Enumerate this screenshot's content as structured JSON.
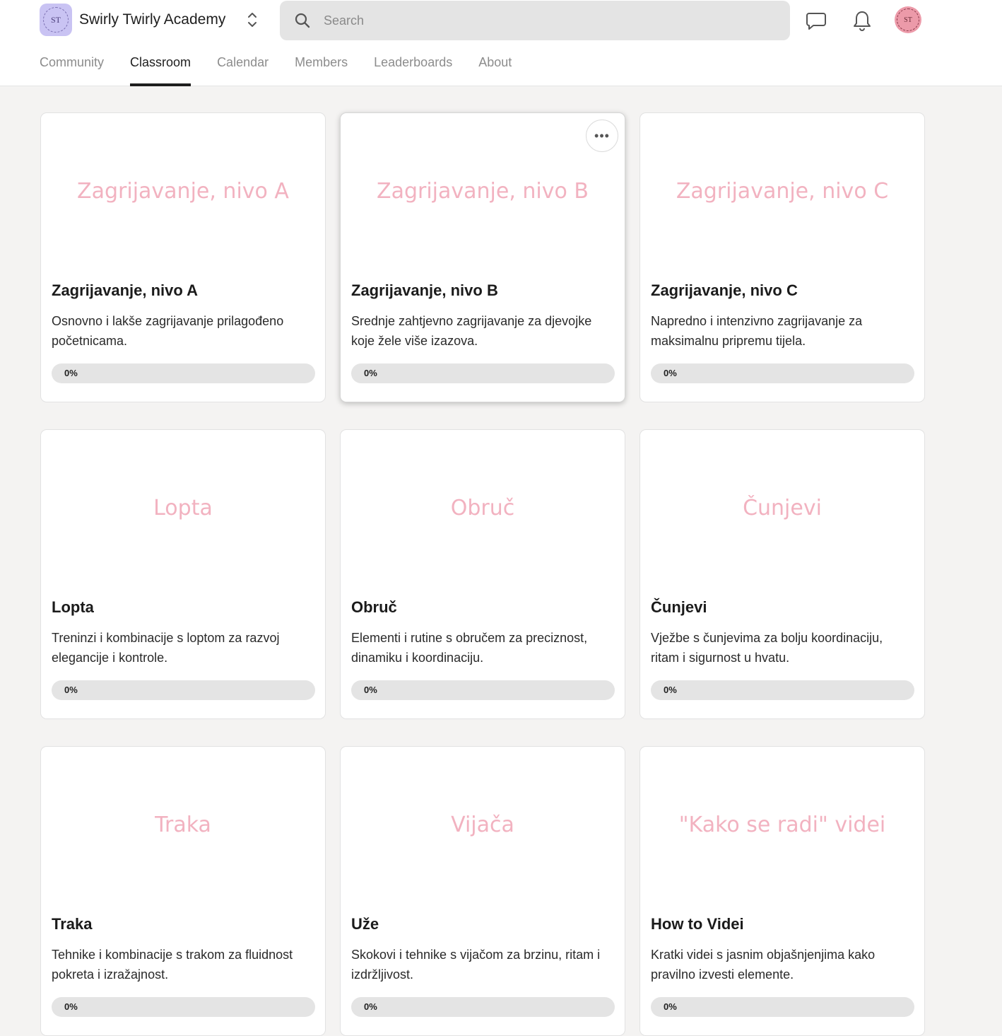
{
  "header": {
    "brand_name": "Swirly Twirly Academy",
    "logo_text": "ST",
    "search_placeholder": "Search",
    "avatar_text": "ST",
    "icons": {
      "search": "search-icon",
      "switcher": "chevron-up-down-icon",
      "chat": "chat-icon",
      "notifications": "bell-icon"
    }
  },
  "tabs": [
    {
      "label": "Community",
      "active": false
    },
    {
      "label": "Classroom",
      "active": true
    },
    {
      "label": "Calendar",
      "active": false
    },
    {
      "label": "Members",
      "active": false
    },
    {
      "label": "Leaderboards",
      "active": false
    },
    {
      "label": "About",
      "active": false
    }
  ],
  "courses": [
    {
      "cover": "Zagrijavanje, nivo A",
      "title": "Zagrijavanje, nivo A",
      "desc": "Osnovno i lakše zagrijavanje prilagođeno početnicama.",
      "progress_label": "0%",
      "progress": 0,
      "hovered": false
    },
    {
      "cover": "Zagrijavanje, nivo B",
      "title": "Zagrijavanje, nivo B",
      "desc": "Srednje zahtjevno zagrijavanje za djevojke koje žele više izazova.",
      "progress_label": "0%",
      "progress": 0,
      "hovered": true,
      "menu": "•••"
    },
    {
      "cover": "Zagrijavanje, nivo C",
      "title": "Zagrijavanje, nivo C",
      "desc": "Napredno i intenzivno zagrijavanje za maksimalnu pripremu tijela.",
      "progress_label": "0%",
      "progress": 0,
      "hovered": false
    },
    {
      "cover": "Lopta",
      "title": "Lopta",
      "desc": "Treninzi i kombinacije s loptom za razvoj elegancije i kontrole.",
      "progress_label": "0%",
      "progress": 0,
      "hovered": false
    },
    {
      "cover": "Obruč",
      "title": "Obruč",
      "desc": "Elementi i rutine s obručem za preciznost, dinamiku i koordinaciju.",
      "progress_label": "0%",
      "progress": 0,
      "hovered": false
    },
    {
      "cover": "Čunjevi",
      "title": "Čunjevi",
      "desc": "Vježbe s čunjevima za bolju koordinaciju, ritam i sigurnost u hvatu.",
      "progress_label": "0%",
      "progress": 0,
      "hovered": false
    },
    {
      "cover": "Traka",
      "title": "Traka",
      "desc": "Tehnike i kombinacije s trakom za fluidnost pokreta i izražajnost.",
      "progress_label": "0%",
      "progress": 0,
      "hovered": false
    },
    {
      "cover": "Vijača",
      "title": "Uže",
      "desc": "Skokovi i tehnike s vijačom za brzinu, ritam i izdržljivost.",
      "progress_label": "0%",
      "progress": 0,
      "hovered": false
    },
    {
      "cover": "\"Kako se radi\" videi",
      "title": "How to Videi",
      "desc": "Kratki videi s jasnim objašnjenjima kako pravilno izvesti elemente.",
      "progress_label": "0%",
      "progress": 0,
      "hovered": false
    }
  ]
}
